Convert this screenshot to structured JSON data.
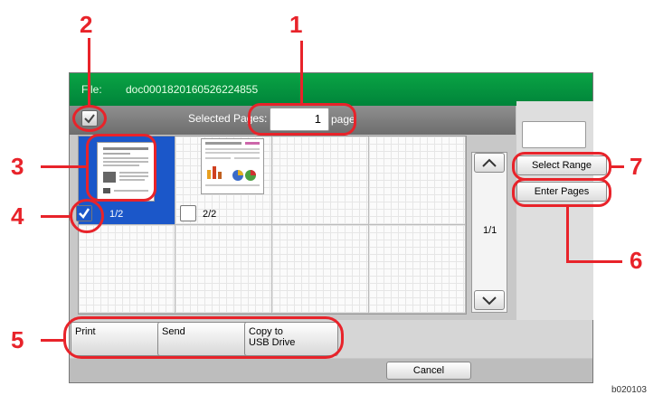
{
  "title_bar": {
    "file_label": "File:",
    "file_name": "doc00018201605262248​55"
  },
  "header": {
    "selected_pages_label": "Selected Pages:",
    "page_value": "1",
    "page_unit": "page"
  },
  "pages": [
    {
      "label": "1/2",
      "selected": true
    },
    {
      "label": "2/2",
      "selected": false
    }
  ],
  "scroll": {
    "page_indicator": "1/1"
  },
  "right_buttons": {
    "select_range": "Select Range",
    "enter_pages": "Enter Pages"
  },
  "bottom_buttons": {
    "print": "Print",
    "send": "Send",
    "copy_usb_line1": "Copy to",
    "copy_usb_line2": "USB Drive"
  },
  "footer": {
    "cancel": "Cancel"
  },
  "callouts": [
    "1",
    "2",
    "3",
    "4",
    "5",
    "6",
    "7"
  ],
  "image_code": "b020103",
  "colors": {
    "title_green": "#00843a",
    "callout_red": "#e8232a",
    "selection_blue": "#1b57c9"
  }
}
